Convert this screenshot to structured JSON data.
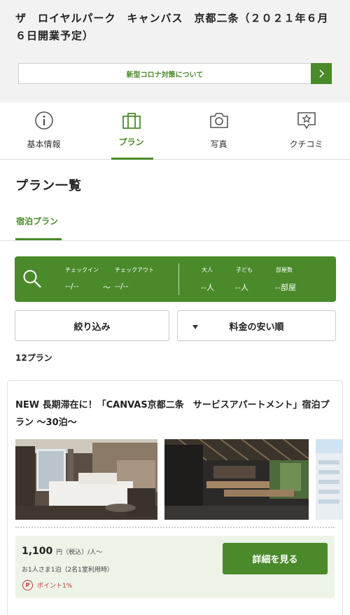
{
  "hotel": {
    "title": "ザ　ロイヤルパーク　キャンバス　京都二条（２０２１年６月６日開業予定）"
  },
  "notice": {
    "label": "新型コロナ対策について"
  },
  "tabs": [
    {
      "label": "基本情報",
      "icon": "info-icon"
    },
    {
      "label": "プラン",
      "icon": "suitcase-icon",
      "active": true
    },
    {
      "label": "写真",
      "icon": "camera-icon"
    },
    {
      "label": "クチコミ",
      "icon": "review-star-icon"
    }
  ],
  "plans": {
    "heading": "プラン一覧",
    "subtab": "宿泊プラン",
    "count_label": "12プラン"
  },
  "search": {
    "checkin_label": "チェックイン",
    "checkout_label": "チェックアウト",
    "checkin_value": "--/--",
    "tilde": "～",
    "checkout_value": "--/--",
    "adults_label": "大人",
    "adults_value": "--人",
    "children_label": "子ども",
    "children_value": "--人",
    "rooms_label": "部屋数",
    "rooms_value": "--部屋"
  },
  "filters": {
    "refine_label": "絞り込み",
    "sort_label": "料金の安い順"
  },
  "plan_card": {
    "name": "NEW 長期滞在に！「CANVAS京都二条　サービスアパートメント」宿泊プラン ～30泊～",
    "price": "1,100",
    "price_unit": "円（税込）/人～",
    "price_sub": "お1人さま1泊（2名1室利用時）",
    "points_badge": "P",
    "points": "ポイント1%",
    "detail_button": "詳細を見る"
  },
  "colors": {
    "accent": "#4a8a2a",
    "points": "#cc3333",
    "price_bg": "#eef3e8"
  }
}
